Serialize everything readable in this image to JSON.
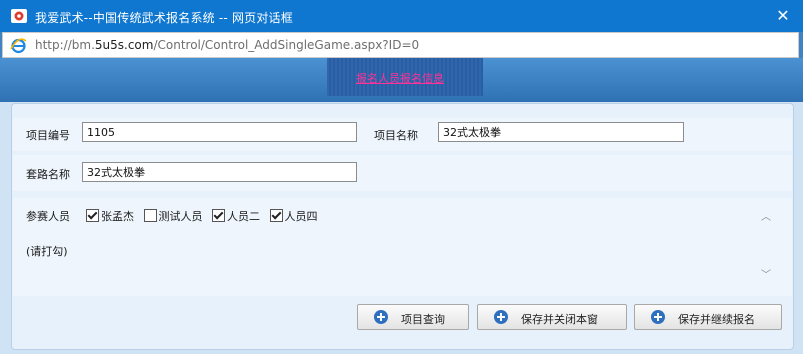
{
  "window": {
    "title": "我爱武术--中国传统武术报名系统 -- 网页对话框",
    "url_prefix": "http://bm.",
    "url_domain": "5u5s.com",
    "url_suffix": "/Control/Control_AddSingleGame.aspx?ID=0"
  },
  "banner": {
    "link_text": "报名人员报名信息"
  },
  "form": {
    "project_code_label": "项目编号",
    "project_code_value": "1105",
    "project_name_label": "项目名称",
    "project_name_value": "32式太极拳",
    "routine_name_label": "套路名称",
    "routine_name_value": "32式太极拳",
    "participants_label": "参赛人员",
    "participants": [
      {
        "name": "张孟杰",
        "checked": true
      },
      {
        "name": "测试人员",
        "checked": false
      },
      {
        "name": "人员二",
        "checked": true
      },
      {
        "name": "人员四",
        "checked": true
      }
    ],
    "hint": "(请打勾)"
  },
  "buttons": {
    "query": "项目查询",
    "save_close": "保存并关闭本窗",
    "save_continue": "保存并继续报名"
  },
  "colors": {
    "titlebar": "#0f77d0",
    "link": "#ff3399",
    "panel": "#e7f1fb"
  }
}
